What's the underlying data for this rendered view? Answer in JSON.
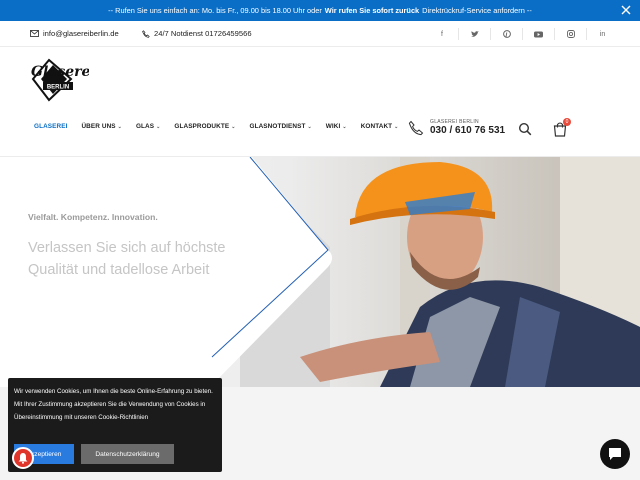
{
  "announcement": {
    "prefix": "-- Rufen Sie uns einfach an: Mo. bis Fr., 09.00 bis 18.00 Uhr oder",
    "bold": "Wir rufen Sie sofort zurück",
    "suffix": "Direktrückruf-Service anfordern --"
  },
  "contact": {
    "email": "info@glasereiberlin.de",
    "emergency": "24/7 Notdienst 01726459566"
  },
  "socials": [
    "facebook-icon",
    "twitter-icon",
    "pinterest-icon",
    "youtube-icon",
    "instagram-icon",
    "linkedin-icon"
  ],
  "logo": {
    "script": "Glaserei",
    "sub": "BERLIN",
    "mark": "GGB"
  },
  "nav": [
    {
      "label": "GLASEREI",
      "active": true,
      "dropdown": false
    },
    {
      "label": "ÜBER UNS",
      "dropdown": true
    },
    {
      "label": "GLAS",
      "dropdown": true
    },
    {
      "label": "GLASPRODUKTE",
      "dropdown": true
    },
    {
      "label": "GLASNOTDIENST",
      "dropdown": true
    },
    {
      "label": "WIKI",
      "dropdown": true
    },
    {
      "label": "KONTAKT",
      "dropdown": true
    }
  ],
  "chevron": "⌄",
  "phone": {
    "small": "GLASEREI BERLIN",
    "number": "030 / 610 76 531"
  },
  "cart": {
    "count": "0"
  },
  "hero": {
    "tagline": "Vielfalt. Kompetenz. Innovation.",
    "title": "Verlassen Sie sich auf höchste Qualität und tadellose Arbeit"
  },
  "cookie": {
    "text": "Wir verwenden Cookies, um Ihnen die beste Online-Erfahrung zu bieten. Mit Ihrer Zustimmung akzeptieren Sie die Verwendung von Cookies in Übereinstimmung mit unseren Cookie-Richtlinien",
    "accept": "Akzeptieren",
    "privacy": "Datenschutzerklärung"
  },
  "colors": {
    "accent": "#0a6ec6",
    "badge": "#e64b3c",
    "cookie_bg": "#1b1b1b"
  }
}
